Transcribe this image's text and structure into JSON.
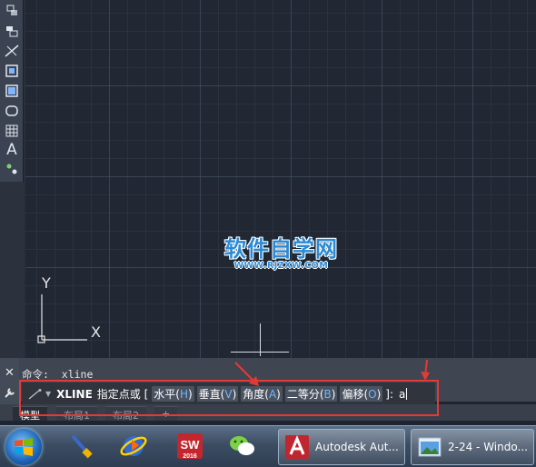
{
  "toolbar": {
    "tools": [
      "layer-states-icon",
      "blocks-icon",
      "xline-icon",
      "zoom-window-icon",
      "zoom-extents-icon",
      "region-icon",
      "table-icon",
      "text-icon",
      "point-style-icon"
    ],
    "text_tool_glyph": "A"
  },
  "watermark": {
    "main": "软件自学网",
    "sub": "WWW.RJZXW.COM"
  },
  "ucs": {
    "x_label": "X",
    "y_label": "Y"
  },
  "command": {
    "close_glyph": "✕",
    "history": "命令: _xline",
    "name": "XLINE",
    "prompt": "指定点或 [",
    "options": [
      {
        "label": "水平(",
        "key": "H",
        "end": ")"
      },
      {
        "label": "垂直(",
        "key": "V",
        "end": ")"
      },
      {
        "label": "角度(",
        "key": "A",
        "end": ")"
      },
      {
        "label": "二等分(",
        "key": "B",
        "end": ")"
      },
      {
        "label": "偏移(",
        "key": "O",
        "end": ")"
      }
    ],
    "suffix": "]:",
    "input_value": "a",
    "dropdown_glyph": "▼"
  },
  "tabs": {
    "items": [
      "模型",
      "布局1",
      "布局2",
      "+"
    ]
  },
  "taskbar": {
    "tasks": [
      {
        "label": "Autodesk Aut..."
      },
      {
        "label": "2-24 - Windo..."
      }
    ],
    "solidworks_year": "2016"
  },
  "colors": {
    "canvas": "#212833",
    "highlight_box": "#e53935",
    "option_key": "#6fb7ff",
    "watermark": "#2b8ad6"
  }
}
